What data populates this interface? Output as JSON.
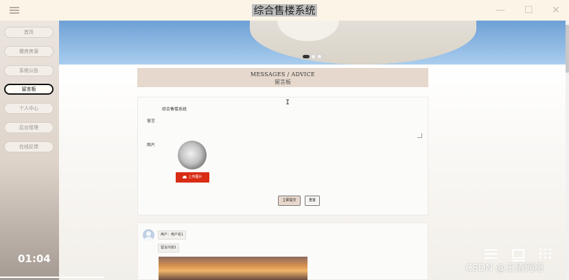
{
  "app": {
    "title": "综合售楼系统"
  },
  "window": {
    "minimize": "—",
    "maximize": "☐",
    "close": "✕"
  },
  "sidebar": {
    "items": [
      {
        "label": "首页"
      },
      {
        "label": "楼房房源"
      },
      {
        "label": "系统公告"
      },
      {
        "label": "留言板",
        "active": true
      },
      {
        "label": "个人中心"
      },
      {
        "label": "后台管理"
      },
      {
        "label": "在线反馈"
      }
    ]
  },
  "section": {
    "title_en": "MESSAGES / ADVICE",
    "title_cn": "留言板"
  },
  "form": {
    "message_label": "留言",
    "message_value": "综合售楼系统",
    "image_label": "图片",
    "upload_label": "上传图片",
    "submit_label": "立即提交",
    "reset_label": "重置"
  },
  "messages": [
    {
      "user": "用户：用户名1",
      "content": "留言内容1"
    }
  ],
  "video": {
    "time": "01:04"
  },
  "watermark": "CSDN @王倩网络",
  "colors": {
    "accent": "#d82c13",
    "header_bg": "#e6d8cc",
    "titlebar_bg": "#fcf4e6"
  }
}
